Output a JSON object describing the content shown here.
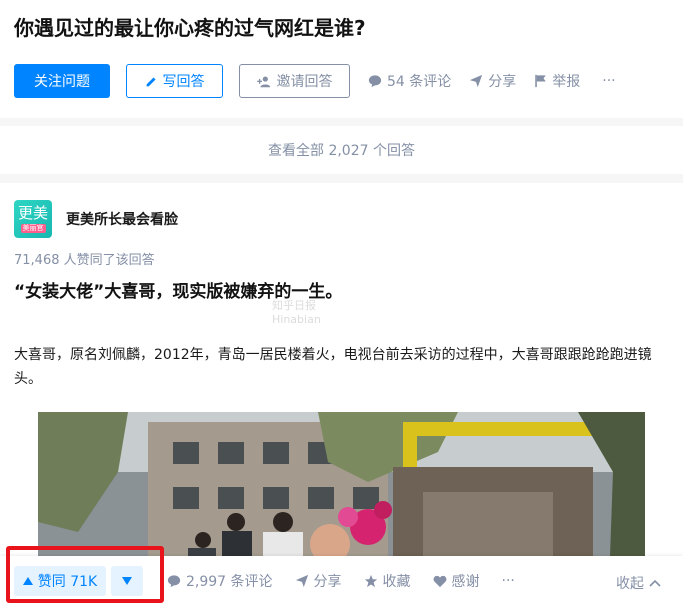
{
  "question": {
    "title": "你遇见过的最让你心疼的过气网红是谁?",
    "follow_label": "关注问题",
    "write_label": "写回答",
    "invite_label": "邀请回答",
    "comments_label": "54 条评论",
    "share_label": "分享",
    "report_label": "举报",
    "more_label": "···"
  },
  "view_all_label": "查看全部 2,027 个回答",
  "answer": {
    "avatar_text": "更美",
    "avatar_sub": "美丽官",
    "author": "更美所长最会看脸",
    "votes_line": "71,468 人赞同了该回答",
    "title": "“女装大佬”大喜哥，现实版被嫌弃的一生。",
    "watermark_line1": "知乎日报",
    "watermark_line2": "Hinabian",
    "text": "大喜哥，原名刘佩麟，2012年，青岛一居民楼着火，电视台前去采访的过程中，大喜哥跟跟跄跄跑进镜头。"
  },
  "action_bar": {
    "upvote_label": "赞同 71K",
    "comments_label": "2,997 条评论",
    "share_label": "分享",
    "favorite_label": "收藏",
    "thanks_label": "感谢",
    "more_label": "···",
    "collapse_label": "收起"
  },
  "colors": {
    "brand_blue": "#0084ff",
    "meta_gray": "#8590a6",
    "highlight_red": "#e8131b"
  }
}
